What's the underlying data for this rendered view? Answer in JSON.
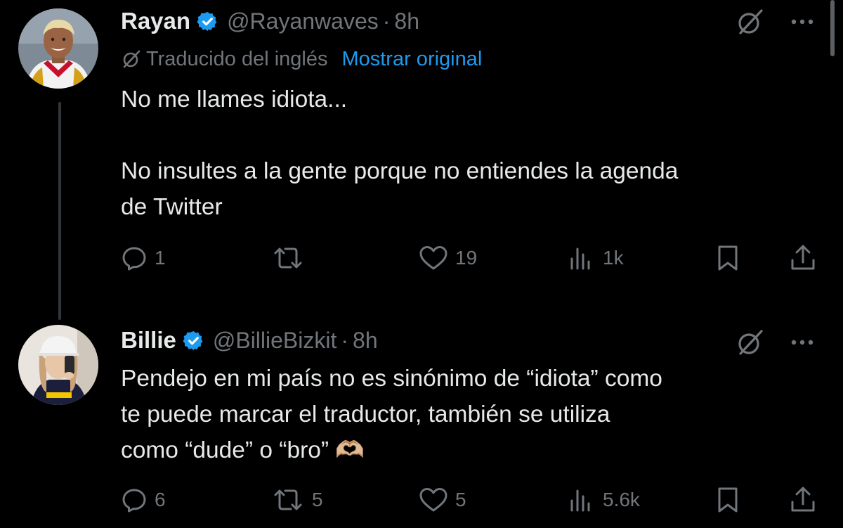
{
  "tweets": [
    {
      "name": "Rayan",
      "handle": "@Rayanwaves",
      "separator": "·",
      "time": "8h",
      "translated_label": "Traducido del inglés",
      "show_original_label": "Mostrar original",
      "text": "No me llames idiota...\n\nNo insultes a la gente porque no entiendes la agenda\nde Twitter",
      "replies": "1",
      "retweets": "",
      "likes": "19",
      "views": "1k"
    },
    {
      "name": "Billie",
      "handle": "@BillieBizkit",
      "separator": "·",
      "time": "8h",
      "text": "Pendejo en mi país no es sinónimo de “idiota” como\nte puede marcar el traductor, también se utiliza\ncomo “dude” o “bro” 🫶🏼",
      "replies": "6",
      "retweets": "5",
      "likes": "5",
      "views": "5.6k"
    }
  ],
  "colors": {
    "background": "#000000",
    "text_primary": "#e7e9ea",
    "text_secondary": "#71767b",
    "link": "#1d9bf0",
    "verified": "#1d9bf0",
    "thread_line": "#333639"
  },
  "icons": {
    "verified": "verified-badge-icon",
    "grok": "grok-icon",
    "more": "more-icon",
    "translate": "translate-icon",
    "reply": "reply-icon",
    "retweet": "retweet-icon",
    "like": "like-icon",
    "views": "views-icon",
    "bookmark": "bookmark-icon",
    "share": "share-icon"
  }
}
